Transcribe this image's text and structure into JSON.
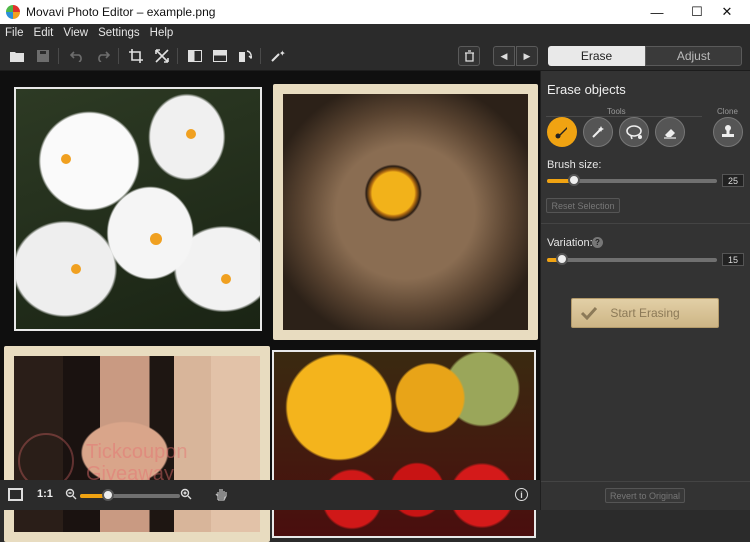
{
  "window": {
    "title": "Movavi Photo Editor – example.png",
    "minimize": "—",
    "maximize": "☐",
    "close": "✕"
  },
  "menu": [
    "File",
    "Edit",
    "View",
    "Settings",
    "Help"
  ],
  "toolbar": {
    "icons": [
      "open-folder-icon",
      "save-icon",
      "undo-icon",
      "redo-icon",
      "crop-icon",
      "fit-icon",
      "compare-side-icon",
      "compare-split-icon",
      "rotate-icon",
      "magic-enhance-icon",
      "delete-icon"
    ],
    "prev": "◀",
    "next": "▶"
  },
  "tabs": {
    "erase": "Erase",
    "adjust": "Adjust",
    "active": "Erase"
  },
  "panel": {
    "heading": "Erase objects",
    "tools_label": "Tools",
    "clone_label": "Clone",
    "brush_size_label": "Brush size:",
    "brush_size_value": "25",
    "brush_size_fraction": 0.16,
    "reset_selection": "Reset Selection",
    "variation_label": "Variation:",
    "variation_help": "?",
    "variation_value": "15",
    "variation_fraction": 0.09,
    "start_erasing": "Start Erasing",
    "revert": "Revert to Original"
  },
  "status": {
    "zoom_ratio": "1:1",
    "zoom_fraction": 0.28,
    "info": "i"
  },
  "watermark": {
    "line1": "Tickcoupon",
    "line2": "Giveaway"
  },
  "colors": {
    "accent": "#f0a312",
    "panel": "#333333",
    "canvas": "#0f0f0f",
    "start_button": "#d9c49a"
  }
}
